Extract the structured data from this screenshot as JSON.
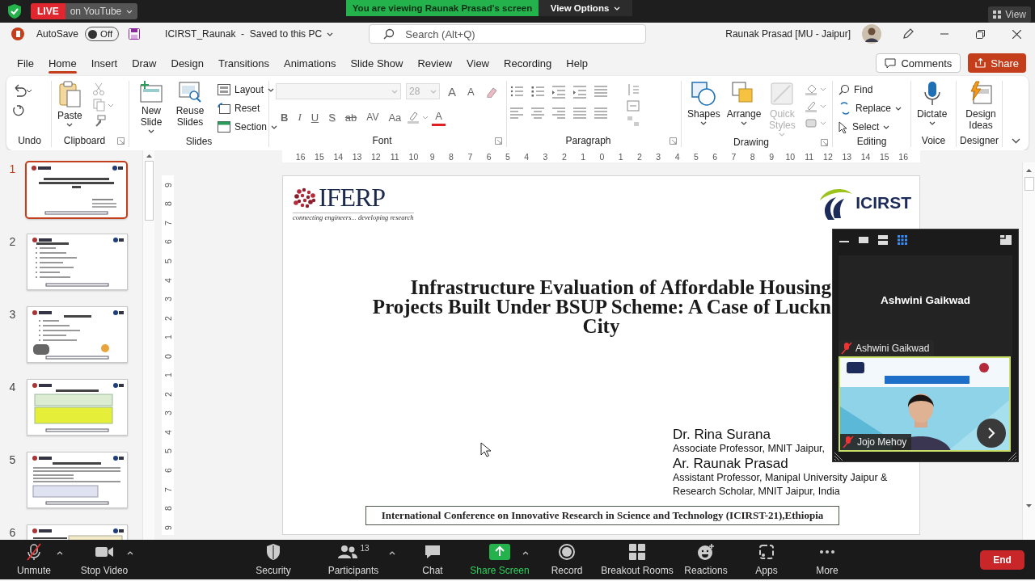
{
  "zoom_top_bar": {
    "live_badge": "LIVE",
    "stream_target": "on YouTube",
    "viewing_banner": "You are viewing Raunak Prasad's screen",
    "view_options": "View Options",
    "view_button": "View"
  },
  "title_bar": {
    "autosave_label": "AutoSave",
    "autosave_on": false,
    "autosave_state": "Off",
    "file_title": "ICIRST_Raunak  -  Saved to this PC",
    "search_placeholder": "Search (Alt+Q)",
    "user_name": "Raunak Prasad [MU - Jaipur]"
  },
  "menu_tabs": [
    {
      "label": "File",
      "selected": false
    },
    {
      "label": "Home",
      "selected": true
    },
    {
      "label": "Insert",
      "selected": false
    },
    {
      "label": "Draw",
      "selected": false
    },
    {
      "label": "Design",
      "selected": false
    },
    {
      "label": "Transitions",
      "selected": false
    },
    {
      "label": "Animations",
      "selected": false
    },
    {
      "label": "Slide Show",
      "selected": false
    },
    {
      "label": "Review",
      "selected": false
    },
    {
      "label": "View",
      "selected": false
    },
    {
      "label": "Recording",
      "selected": false
    },
    {
      "label": "Help",
      "selected": false
    }
  ],
  "comments_button": "Comments",
  "share_button": "Share",
  "ribbon": [
    {
      "kind": "undo",
      "label": "Undo"
    },
    {
      "kind": "clipboard",
      "label": "Clipboard",
      "buttons": [
        {
          "label": "Paste"
        }
      ]
    },
    {
      "kind": "slides",
      "label": "Slides",
      "buttons": [
        {
          "label": "New Slide"
        },
        {
          "label": "Reuse Slides"
        },
        {
          "label": "Layout"
        },
        {
          "label": "Reset"
        },
        {
          "label": "Section"
        }
      ]
    },
    {
      "kind": "font",
      "label": "Font",
      "font_size": "28",
      "buttons": [
        {
          "label": "A",
          "kind": "grow"
        },
        {
          "label": "A",
          "kind": "shrink"
        },
        {
          "label": "B",
          "kind": "bold"
        },
        {
          "label": "I",
          "kind": "italic"
        },
        {
          "label": "U",
          "kind": "underline"
        },
        {
          "label": "S",
          "kind": "shadow"
        },
        {
          "label": "ab",
          "kind": "strike"
        },
        {
          "label": "AV",
          "kind": "spacing"
        },
        {
          "label": "Aa",
          "kind": "case"
        },
        {
          "label": "A",
          "kind": "color"
        }
      ]
    },
    {
      "kind": "paragraph",
      "label": "Paragraph"
    },
    {
      "kind": "drawing",
      "label": "Drawing",
      "buttons": [
        {
          "label": "Shapes",
          "disabled": false
        },
        {
          "label": "Arrange",
          "disabled": false
        },
        {
          "label": "Quick Styles",
          "disabled": true
        }
      ]
    },
    {
      "kind": "editing",
      "label": "Editing",
      "buttons": [
        {
          "label": "Find"
        },
        {
          "label": "Replace"
        },
        {
          "label": "Select"
        }
      ]
    },
    {
      "kind": "voice",
      "label": "Voice",
      "buttons": [
        {
          "label": "Dictate"
        }
      ]
    },
    {
      "kind": "designer",
      "label": "Designer",
      "buttons": [
        {
          "label": "Design Ideas"
        }
      ]
    }
  ],
  "rulers": {
    "horizontal": [
      "16",
      "15",
      "14",
      "13",
      "12",
      "11",
      "10",
      "9",
      "8",
      "7",
      "6",
      "5",
      "4",
      "3",
      "2",
      "1",
      "0",
      "1",
      "2",
      "3",
      "4",
      "5",
      "6",
      "7",
      "8",
      "9",
      "10",
      "11",
      "12",
      "13",
      "14",
      "15",
      "16"
    ],
    "vertical": [
      "9",
      "8",
      "7",
      "6",
      "5",
      "4",
      "3",
      "2",
      "1",
      "0",
      "1",
      "2",
      "3",
      "4",
      "5",
      "6",
      "7",
      "8",
      "9"
    ]
  },
  "slides_pane": [
    {
      "number": "1",
      "selected": true
    },
    {
      "number": "2",
      "selected": false
    },
    {
      "number": "3",
      "selected": false
    },
    {
      "number": "4",
      "selected": false
    },
    {
      "number": "5",
      "selected": false
    },
    {
      "number": "6",
      "selected": false
    }
  ],
  "slide": {
    "logos": [
      {
        "kind": "iferp",
        "name": "IFERP",
        "tagline": "connecting engineers... developing research"
      },
      {
        "kind": "icirst",
        "name": "ICIRST"
      }
    ],
    "title_lines": [
      "Infrastructure Evaluation of Affordable Housing",
      "Projects Built Under BSUP Scheme: A Case of Luckn",
      "City"
    ],
    "authors": [
      {
        "name": "Dr. Rina Surana",
        "affiliation": [
          "Associate Professor, MNIT Jaipur,"
        ]
      },
      {
        "name": "Ar. Raunak Prasad",
        "affiliation": [
          "Assistant Professor, Manipal University Jaipur &",
          "Research Scholar, MNIT Jaipur, India"
        ]
      }
    ],
    "footer": "International Conference on Innovative Research in Science and Technology (ICIRST-21),Ethiopia"
  },
  "video_panel": {
    "tiles": [
      {
        "kind": "audio",
        "display_name": "Ashwini Gaikwad",
        "name": "Ashwini Gaikwad",
        "muted": true
      },
      {
        "kind": "video",
        "name": "Jojo Mehoy",
        "muted": true
      }
    ]
  },
  "meeting_controls": [
    {
      "kind": "mic",
      "label": "Unmute",
      "has_menu": true
    },
    {
      "kind": "video",
      "label": "Stop Video",
      "has_menu": true
    },
    {
      "kind": "security",
      "label": "Security",
      "has_menu": false
    },
    {
      "kind": "participants",
      "label": "Participants",
      "count": "13",
      "has_menu": true
    },
    {
      "kind": "chat",
      "label": "Chat",
      "has_menu": false
    },
    {
      "kind": "share",
      "label": "Share Screen",
      "has_menu": true
    },
    {
      "kind": "record",
      "label": "Record",
      "has_menu": false
    },
    {
      "kind": "rooms",
      "label": "Breakout Rooms",
      "has_menu": false
    },
    {
      "kind": "reactions",
      "label": "Reactions",
      "has_menu": false
    },
    {
      "kind": "apps",
      "label": "Apps",
      "has_menu": false
    },
    {
      "kind": "more",
      "label": "More",
      "has_menu": false
    }
  ],
  "end_button": "End"
}
